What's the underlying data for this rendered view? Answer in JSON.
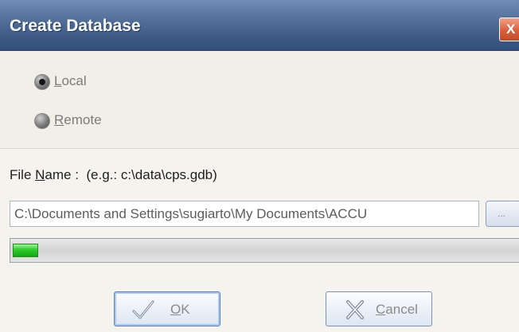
{
  "window": {
    "title": "Create Database",
    "close_glyph": "X"
  },
  "location": {
    "local": {
      "pre": "",
      "mnemonic": "L",
      "post": "ocal",
      "checked": true
    },
    "remote": {
      "pre": "",
      "mnemonic": "R",
      "post": "emote",
      "checked": false
    }
  },
  "file": {
    "label_pre": "File ",
    "label_mnemonic": "N",
    "label_post": "ame :  (e.g.: c:\\data\\cps.gdb)",
    "path_value": "C:\\Documents and Settings\\sugiarto\\My Documents\\ACCU",
    "browse_label": "..."
  },
  "progress": {
    "fraction": 0.05,
    "color": "#22bf1e"
  },
  "buttons": {
    "ok": {
      "mnemonic": "O",
      "post": "K",
      "icon": "check-icon"
    },
    "cancel": {
      "mnemonic": "C",
      "post": "ancel",
      "icon": "cancel-x-icon"
    }
  }
}
